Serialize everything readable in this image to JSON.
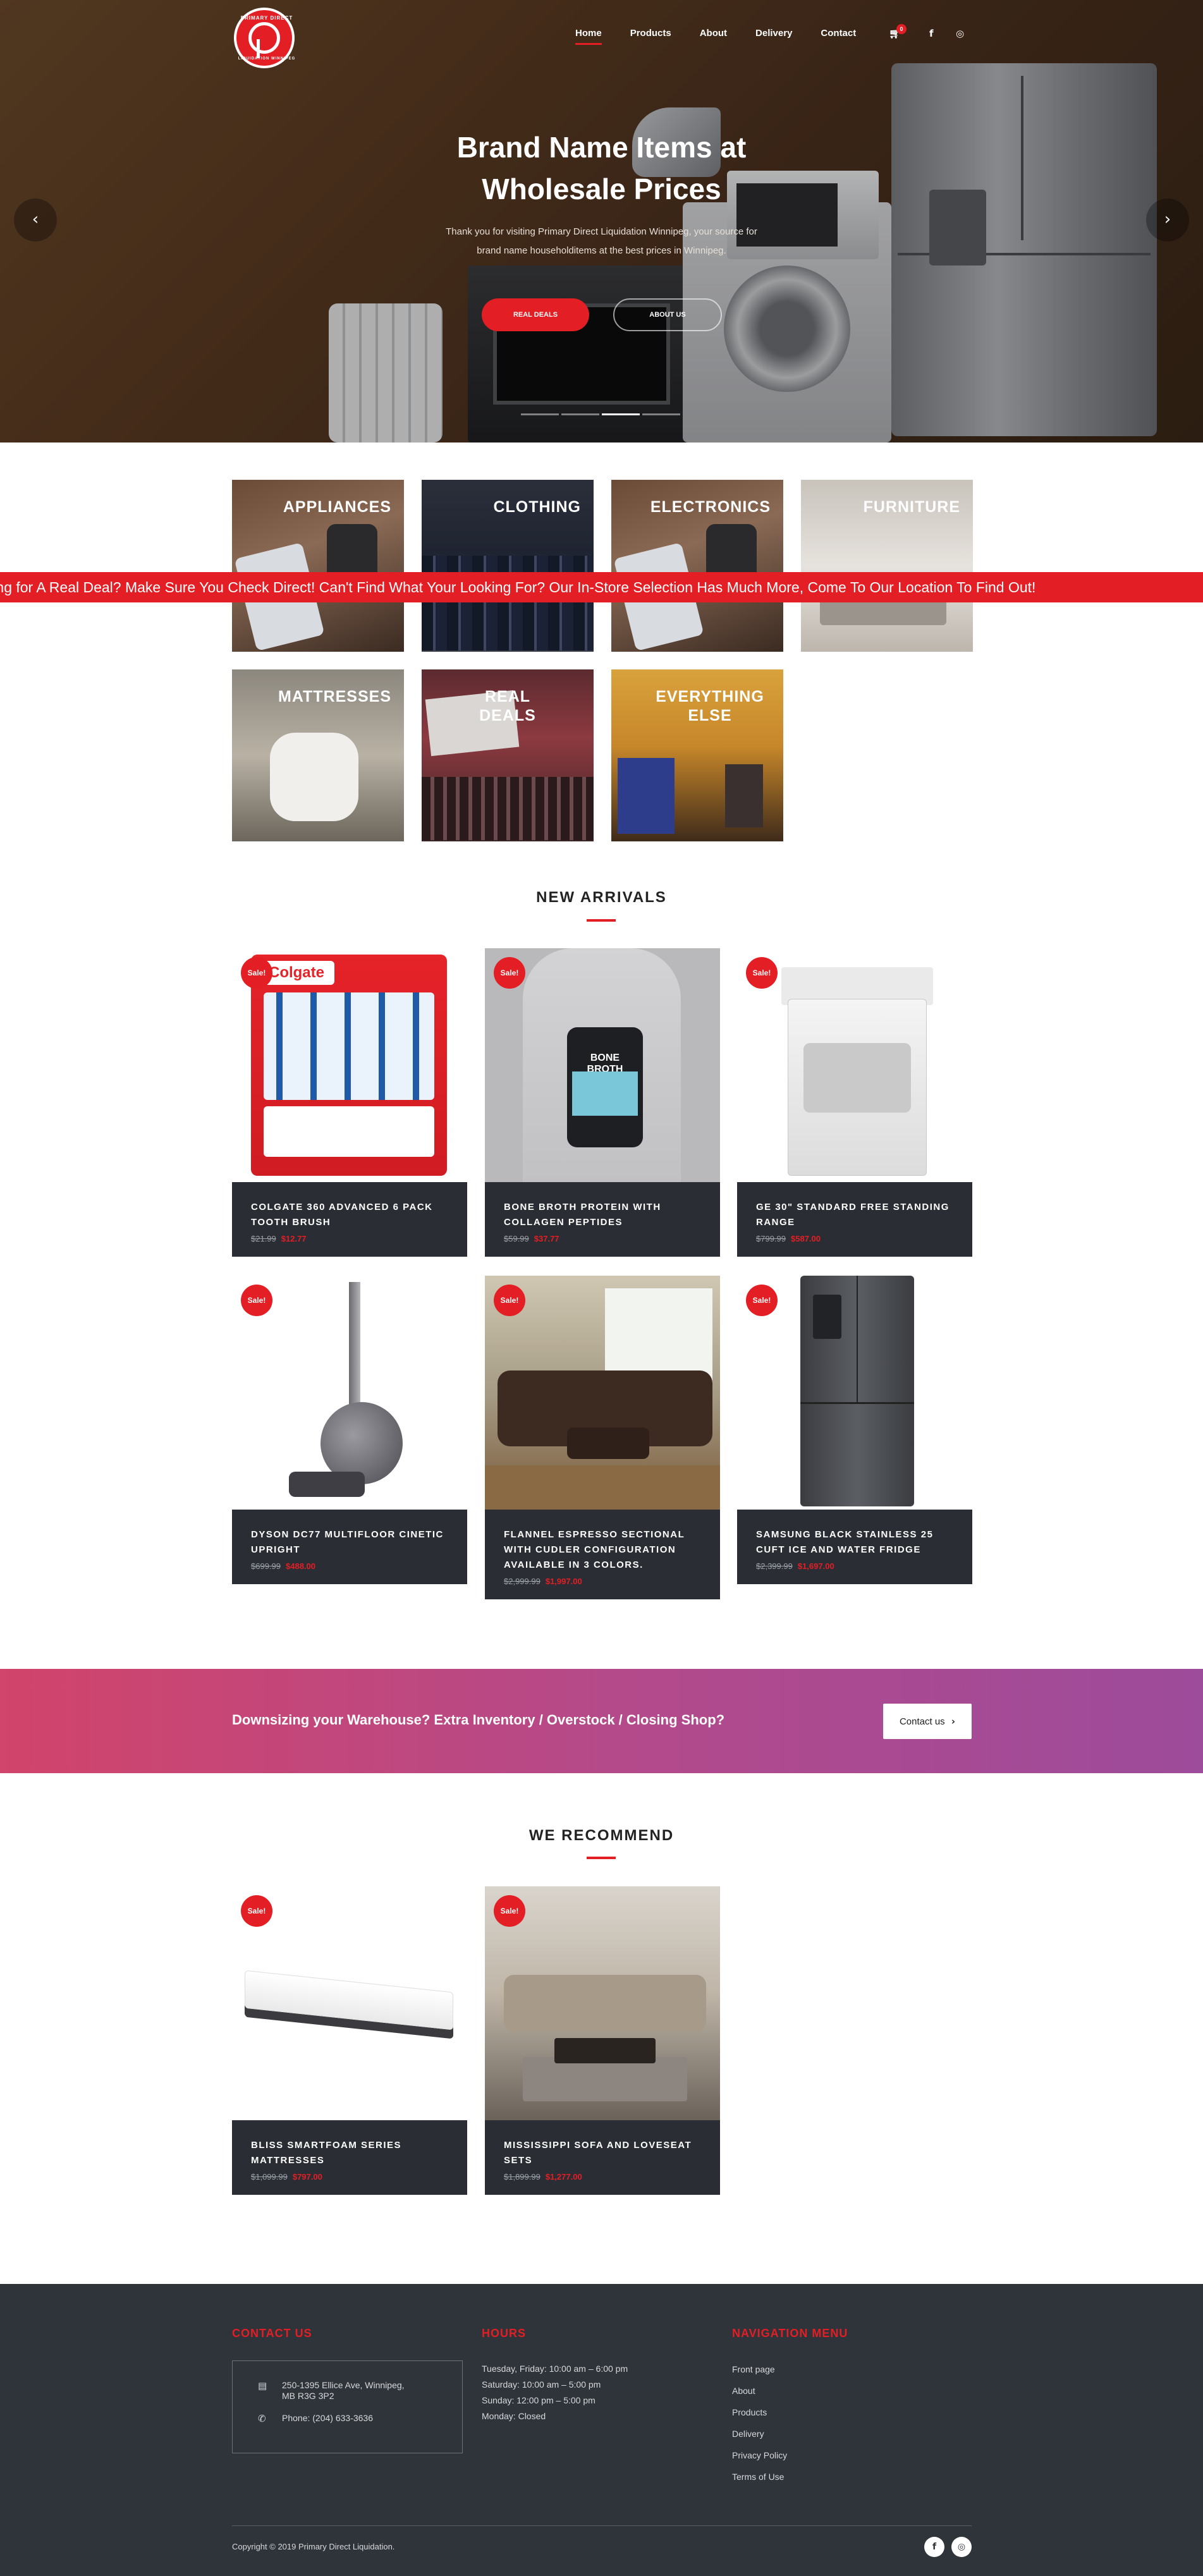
{
  "nav": {
    "logo_top": "PRIMARY DIRECT",
    "logo_bottom": "LIQUIDATION WINNIPEG",
    "items": [
      {
        "label": "Home"
      },
      {
        "label": "Products"
      },
      {
        "label": "About"
      },
      {
        "label": "Delivery"
      },
      {
        "label": "Contact"
      }
    ],
    "cart_icon": "cart-icon",
    "cart_count": "0",
    "facebook_icon": "facebook-icon",
    "instagram_icon": "instagram-icon"
  },
  "hero": {
    "title_line1": "Brand Name Items at",
    "title_line2": "Wholesale Prices",
    "subtitle_line1": "Thank you for visiting Primary Direct Liquidation Winnipeg, your source for",
    "subtitle_line2": "brand name householditems at the best prices in Winnipeg.",
    "primary_button": "REAL DEALS",
    "secondary_button": "ABOUT US",
    "prev_icon": "chevron-left-icon",
    "next_icon": "chevron-right-icon",
    "slides_total": 4,
    "active_slide": 3
  },
  "categories": [
    {
      "label": "APPLIANCES"
    },
    {
      "label": "CLOTHING"
    },
    {
      "label": "ELECTRONICS"
    },
    {
      "label": "FURNITURE"
    },
    {
      "label": "MATTRESSES"
    },
    {
      "label": "REAL DEALS"
    },
    {
      "label": "EVERYTHING ELSE"
    }
  ],
  "ticker": {
    "text": "oking for A Real Deal? Make Sure You Check Direct! Can't Find What Your Looking For? Our In-Store Selection Has Much More, Come To Our Location To Find Out!"
  },
  "new_arrivals": {
    "title": "NEW ARRIVALS",
    "sale_badge": "Sale!",
    "products": [
      {
        "name": "COLGATE 360 ADVANCED 6 PACK TOOTH BRUSH",
        "old_price": "$21.99",
        "price": "$12.77"
      },
      {
        "name": "BONE BROTH PROTEIN WITH COLLAGEN PEPTIDES",
        "old_price": "$59.99",
        "price": "$37.77",
        "jar_text": "BONE BROTH PROTEIN"
      },
      {
        "name": "GE 30\" STANDARD FREE STANDING RANGE",
        "old_price": "$799.99",
        "price": "$587.00"
      },
      {
        "name": "DYSON DC77 MULTIFLOOR CINETIC UPRIGHT",
        "old_price": "$699.99",
        "price": "$488.00"
      },
      {
        "name": "FLANNEL ESPRESSO SECTIONAL WITH CUDLER CONFIGURATION AVAILABLE IN 3 COLORS.",
        "old_price": "$2,999.99",
        "price": "$1,997.00"
      },
      {
        "name": "SAMSUNG BLACK STAINLESS 25 CUFT ICE AND WATER FRIDGE",
        "old_price": "$2,399.99",
        "price": "$1,697.00"
      }
    ]
  },
  "cta": {
    "text": "Downsizing your Warehouse? Extra Inventory / Overstock / Closing Shop?",
    "button": "Contact us",
    "button_icon": "chevron-right-icon"
  },
  "recommend": {
    "title": "WE RECOMMEND",
    "sale_badge": "Sale!",
    "products": [
      {
        "name": "BLISS SMARTFOAM SERIES MATTRESSES",
        "old_price": "$1,099.99",
        "price": "$797.00"
      },
      {
        "name": "MISSISSIPPI SOFA AND LOVESEAT SETS",
        "old_price": "$1,899.99",
        "price": "$1,277.00"
      }
    ]
  },
  "footer": {
    "contact_title": "CONTACT US",
    "address_line1": "250-1395 Ellice Ave, Winnipeg,",
    "address_line2": "MB R3G 3P2",
    "phone": "Phone: (204) 633-3636",
    "address_icon": "building-icon",
    "phone_icon": "phone-icon",
    "hours_title": "HOURS",
    "hours": [
      "Tuesday, Friday: 10:00 am – 6:00 pm",
      "Saturday: 10:00 am – 5:00 pm",
      "Sunday: 12:00 pm – 5:00 pm",
      "Monday: Closed"
    ],
    "menu_title": "NAVIGATION MENU",
    "menu": [
      "Front page",
      "About",
      "Products",
      "Delivery",
      "Privacy Policy",
      "Terms of Use"
    ],
    "copyright": "Copyright © 2019 Primary Direct Liquidation.",
    "facebook_icon": "facebook-icon",
    "instagram_icon": "instagram-icon"
  },
  "colors": {
    "accent": "#e31e24",
    "footer_bg": "#2f333a",
    "card_info_bg": "#2a2e34"
  }
}
